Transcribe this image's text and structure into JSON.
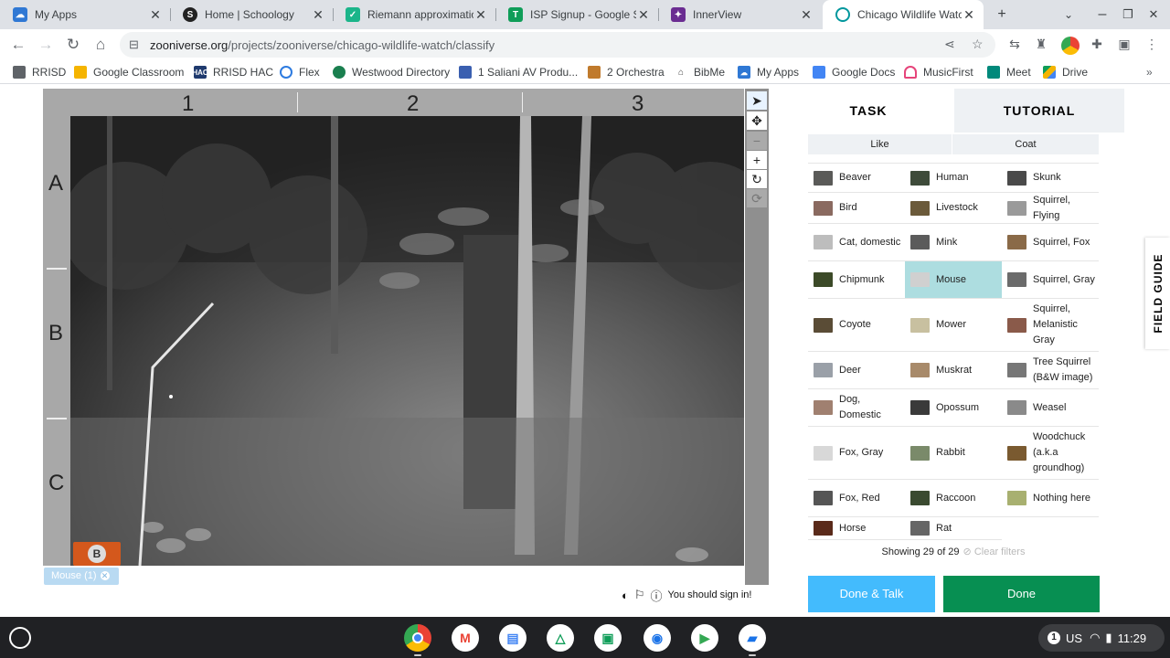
{
  "tabs": [
    {
      "label": "My Apps",
      "icon": "zoonie-icon"
    },
    {
      "label": "Home | Schoology",
      "icon": "schoology-icon"
    },
    {
      "label": "Riemann approximatio",
      "icon": "check-shield-icon"
    },
    {
      "label": "ISP Signup - Google Sh",
      "icon": "sheets-icon"
    },
    {
      "label": "InnerView",
      "icon": "innerview-icon"
    },
    {
      "label": "Chicago Wildlife Watc",
      "icon": "zooniverse-icon",
      "active": true
    }
  ],
  "toolbar": {
    "url_host": "zooniverse.org",
    "url_path": "/projects/zooniverse/chicago-wildlife-watch/classify"
  },
  "bookmarks": [
    {
      "label": "RRISD",
      "icon": "folder-icon"
    },
    {
      "label": "Google Classroom",
      "icon": "classroom-icon"
    },
    {
      "label": "RRISD HAC",
      "icon": "hac-icon"
    },
    {
      "label": "Flex",
      "icon": "flex-icon"
    },
    {
      "label": "Westwood Directory",
      "icon": "westwood-icon"
    },
    {
      "label": "1 Saliani AV Produ...",
      "icon": "calendar-icon"
    },
    {
      "label": "2 Orchestra",
      "icon": "orchestra-icon"
    },
    {
      "label": "BibMe",
      "icon": "bibme-icon"
    },
    {
      "label": "My Apps",
      "icon": "zoonie-icon"
    },
    {
      "label": "Google Docs",
      "icon": "docs-icon"
    },
    {
      "label": "MusicFirst",
      "icon": "musicfirst-icon"
    },
    {
      "label": "Meet",
      "icon": "meet-icon"
    },
    {
      "label": "Drive",
      "icon": "drive-icon"
    }
  ],
  "viewer": {
    "columns": [
      "1",
      "2",
      "3"
    ],
    "rows": [
      "A",
      "B",
      "C"
    ],
    "logo_badge": "B",
    "mark_chip": "Mouse (1)",
    "sign_in_notice": "You should sign in!"
  },
  "panel": {
    "tab_task": "TASK",
    "tab_tutorial": "TUTORIAL",
    "filters": [
      "Like",
      "Coat"
    ],
    "species": [
      {
        "label": "Beaver",
        "thumb": "#5a5a58"
      },
      {
        "label": "Human",
        "thumb": "#3e4b3a"
      },
      {
        "label": "Skunk",
        "thumb": "#4a4a4a"
      },
      {
        "label": "Bird",
        "thumb": "#8a6a60"
      },
      {
        "label": "Livestock",
        "thumb": "#6b5a3a"
      },
      {
        "label": "Squirrel, Flying",
        "thumb": "#9a9a9a"
      },
      {
        "label": "Cat, domestic",
        "thumb": "#bdbdbd"
      },
      {
        "label": "Mink",
        "thumb": "#5b5b5b"
      },
      {
        "label": "Squirrel, Fox",
        "thumb": "#8a6a48"
      },
      {
        "label": "Chipmunk",
        "thumb": "#3c4a28"
      },
      {
        "label": "Mouse",
        "thumb": "#d0d0d0"
      },
      {
        "label": "Squirrel, Gray",
        "thumb": "#6b6b6b"
      },
      {
        "label": "Coyote",
        "thumb": "#5a4c36"
      },
      {
        "label": "Mower",
        "thumb": "#c8c0a0"
      },
      {
        "label": "Squirrel, Melanistic Gray",
        "thumb": "#8a5a4a"
      },
      {
        "label": "Deer",
        "thumb": "#9aa0a8"
      },
      {
        "label": "Muskrat",
        "thumb": "#a88a6a"
      },
      {
        "label": "Tree Squirrel (B&W image)",
        "thumb": "#777777"
      },
      {
        "label": "Dog, Domestic",
        "thumb": "#a08070"
      },
      {
        "label": "Opossum",
        "thumb": "#3a3a3a"
      },
      {
        "label": "Weasel",
        "thumb": "#8a8a8a"
      },
      {
        "label": "Fox, Gray",
        "thumb": "#d8d8d8"
      },
      {
        "label": "Rabbit",
        "thumb": "#7a8a6a"
      },
      {
        "label": "Woodchuck (a.k.a groundhog)",
        "thumb": "#7a5a30"
      },
      {
        "label": "Fox, Red",
        "thumb": "#555555"
      },
      {
        "label": "Raccoon",
        "thumb": "#3a4a30"
      },
      {
        "label": "Nothing here",
        "thumb": "#a8b070"
      },
      {
        "label": "Horse",
        "thumb": "#5a2a1a"
      },
      {
        "label": "Rat",
        "thumb": "#666666"
      }
    ],
    "selected_species": "Mouse",
    "status_text": "Showing 29 of 29",
    "clear_filters": "Clear filters",
    "done_talk": "Done & Talk",
    "done": "Done",
    "field_guide": "FIELD GUIDE"
  },
  "shelf": {
    "lang": "US",
    "time": "11:29",
    "notification_count": "1"
  },
  "colors": {
    "selected_cell": "#addde0",
    "done_talk_button": "#43bbfd",
    "done_button": "#078f52"
  }
}
